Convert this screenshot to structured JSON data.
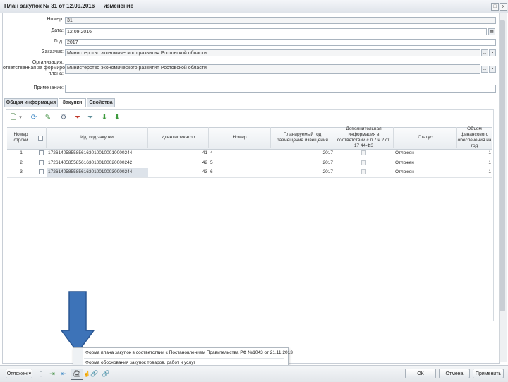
{
  "window": {
    "title": "План закупок № 31 от 12.09.2016 — изменение",
    "restore_glyph": "□",
    "close_glyph": "x"
  },
  "form": {
    "number_label": "Номер:",
    "number_value": "31",
    "date_label": "Дата:",
    "date_value": "12.09.2016",
    "year_label": "Год:",
    "year_value": "2017",
    "customer_label": "Заказчик:",
    "customer_value": "Министерство экономического развития Ростовской области",
    "org_label_1": "Организация,",
    "org_label_2": "ответственная за формирование",
    "org_label_3": "плана:",
    "org_value": "Министерство экономического развития Ростовской области",
    "note_label": "Примечание:",
    "note_value": "",
    "lookup_glyph": "...",
    "calendar_glyph": "▦"
  },
  "tabs": [
    {
      "label": "Общая информация"
    },
    {
      "label": "Закупки"
    },
    {
      "label": "Свойства"
    }
  ],
  "toolbar": {
    "add_glyph": "🗋",
    "dropdown_glyph": "▾",
    "refresh_glyph": "⟳",
    "edit_glyph": "✎",
    "settings_glyph": "⚙",
    "filter_glyph": "⏷",
    "import_glyph": "⬇",
    "export_glyph": "⬇"
  },
  "table": {
    "headers": [
      "Номер строки",
      "",
      "Ид. код закупки",
      "Идентификатор",
      "Номер",
      "Планируемый год размещения извещения",
      "Дополнительная информация в соответствии с п.7 ч.2 ст. 17 44-ФЗ",
      "Статус",
      "Объем финансового обеспечения на год"
    ],
    "rows": [
      {
        "num": "1",
        "code": "172614058558561630100100010000244",
        "ident": "41",
        "number": "4",
        "year": "2017",
        "status": "Отложен",
        "amount": "1"
      },
      {
        "num": "2",
        "code": "172614058558561630100100020000242",
        "ident": "42",
        "number": "5",
        "year": "2017",
        "status": "Отложен",
        "amount": "1"
      },
      {
        "num": "3",
        "code": "172614058558561630100100030000244",
        "ident": "43",
        "number": "6",
        "year": "2017",
        "status": "Отложен",
        "amount": "1"
      }
    ]
  },
  "bottom": {
    "status_button": "Отложен",
    "status_arrow": "▾",
    "ok_button": "ОК",
    "cancel_button": "Отмена",
    "apply_button": "Применить",
    "print_glyph": "🖨",
    "link_glyph": "🔗"
  },
  "popup": {
    "items": [
      "Форма плана закупок в соответствии с Постановлением Правительства РФ №1043 от 21.11.2013",
      "Форма обоснования закупок товаров, работ и услуг"
    ]
  },
  "colors": {
    "arrow": "#3d73b8",
    "arrow_border": "#2a5692",
    "accent": "#4a7cc2"
  }
}
